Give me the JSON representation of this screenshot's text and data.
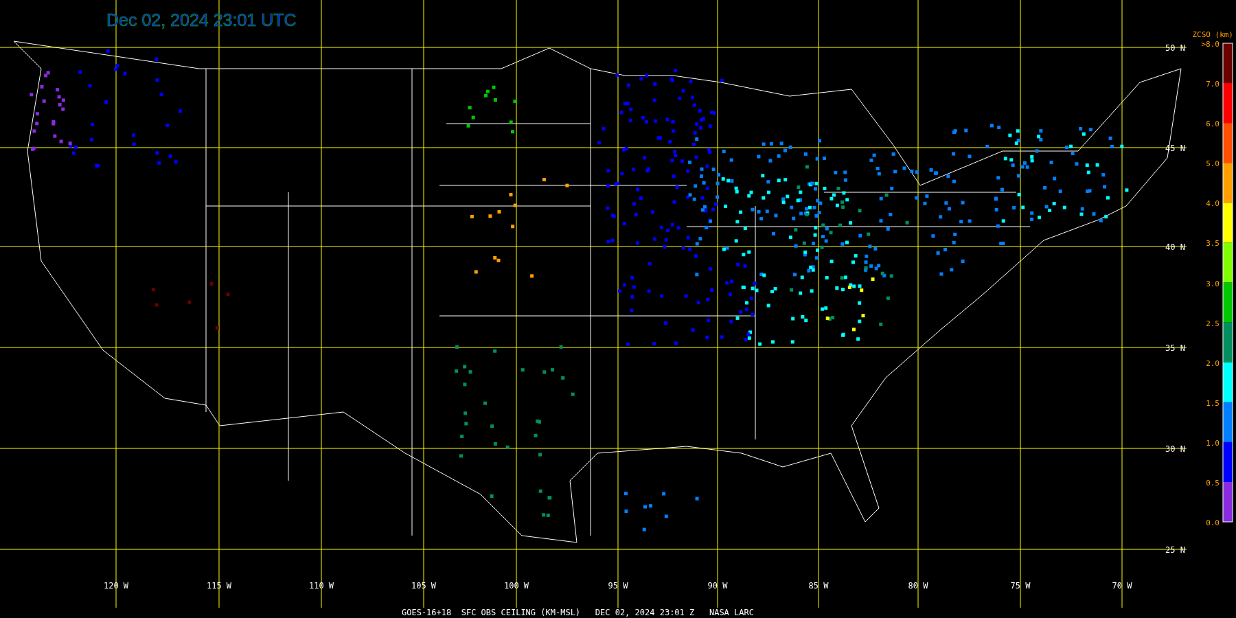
{
  "title": "Dec 02, 2024 23:01 UTC",
  "latitude_labels": [
    "50 N",
    "45 N",
    "40 N",
    "35 N",
    "30 N",
    "25 N"
  ],
  "longitude_labels": [
    "120 W",
    "115 W",
    "110 W",
    "105 W",
    "100 W",
    "95 W",
    "90 W",
    "85 W",
    "80 W",
    "75 W",
    "70 W"
  ],
  "legend": {
    "title": "ZCSO (km)",
    "labels": [
      ">8.0",
      "7.0",
      "6.0",
      "5.0",
      "4.0",
      "3.5",
      "3.0",
      "2.5",
      "2.0",
      "1.5",
      "1.0",
      "0.5",
      "0.0"
    ],
    "bins": [
      {
        "color": "#6a0000"
      },
      {
        "color": "#ff0000"
      },
      {
        "color": "#ff5000"
      },
      {
        "color": "#ffa000"
      },
      {
        "color": "#ffff00"
      },
      {
        "color": "#80ff00"
      },
      {
        "color": "#00c800"
      },
      {
        "color": "#009060"
      },
      {
        "color": "#00ffff"
      },
      {
        "color": "#0080ff"
      },
      {
        "color": "#0000ff"
      },
      {
        "color": "#8a2be2"
      }
    ]
  },
  "footer": "GOES-16+18  SFC OBS CEILING (KM-MSL)   DEC 02, 2024 23:01 Z   NASA LARC"
}
